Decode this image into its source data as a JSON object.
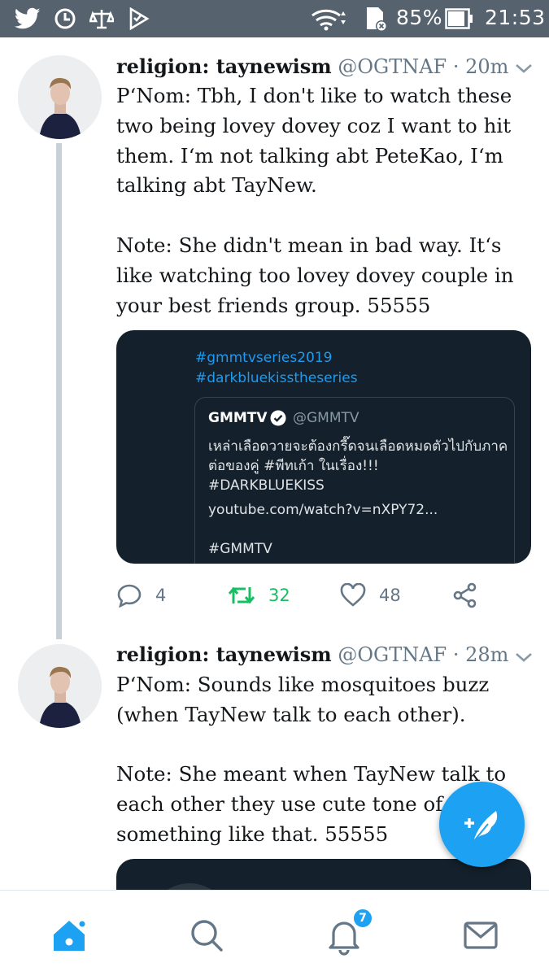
{
  "statusbar": {
    "battery": "85%",
    "time": "21:53",
    "icons": [
      "twitter-icon",
      "sync-icon",
      "scale-icon",
      "checklist-icon",
      "wifi-icon",
      "sim-icon",
      "battery-icon"
    ]
  },
  "tweets": [
    {
      "name": "religion: taynewism",
      "handle": "@OGTNAF",
      "time": "· 20m",
      "text": "P‘Nom: Tbh, I don't like to watch these two being lovey dovey coz I want to hit them. I‘m not talking abt PeteKao, I‘m talking abt TayNew.\n\nNote: She didn't mean in bad way. It‘s like watching too lovey dovey couple in your best friends group. 55555",
      "card": {
        "hashtag1": "#gmmtvseries2019",
        "hashtag2": "#darkbluekisstheseries",
        "quote_name": "GMMTV",
        "quote_handle": "@GMMTV",
        "quote_text": "เหล่าเลือดวายจะต้องกรี๊ดจนเลือดหมดตัวไปกับภาคต่อของคู่ #พีทเก้า ในเรื่อง!!!\n#DARKBLUEKISS",
        "quote_link": "youtube.com/watch?v=nXPY72...",
        "quote_tag": "#GMMTV"
      },
      "replies": "4",
      "retweets": "32",
      "likes": "48"
    },
    {
      "name": "religion: taynewism",
      "handle": "@OGTNAF",
      "time": "· 28m",
      "text": "P‘Nom: Sounds like mosquitoes buzz (when TayNew talk to each other).\n\nNote: She meant when TayNew talk to each other they use cute tone of v\nsomething like that. 55555"
    }
  ],
  "nav": {
    "notifications_badge": "7",
    "items": [
      "home-icon",
      "search-icon",
      "notifications-icon",
      "messages-icon"
    ]
  },
  "colors": {
    "accent": "#1da1f2",
    "retweet": "#17bf63",
    "statusbar": "#56636f",
    "card_bg": "#14202b"
  }
}
